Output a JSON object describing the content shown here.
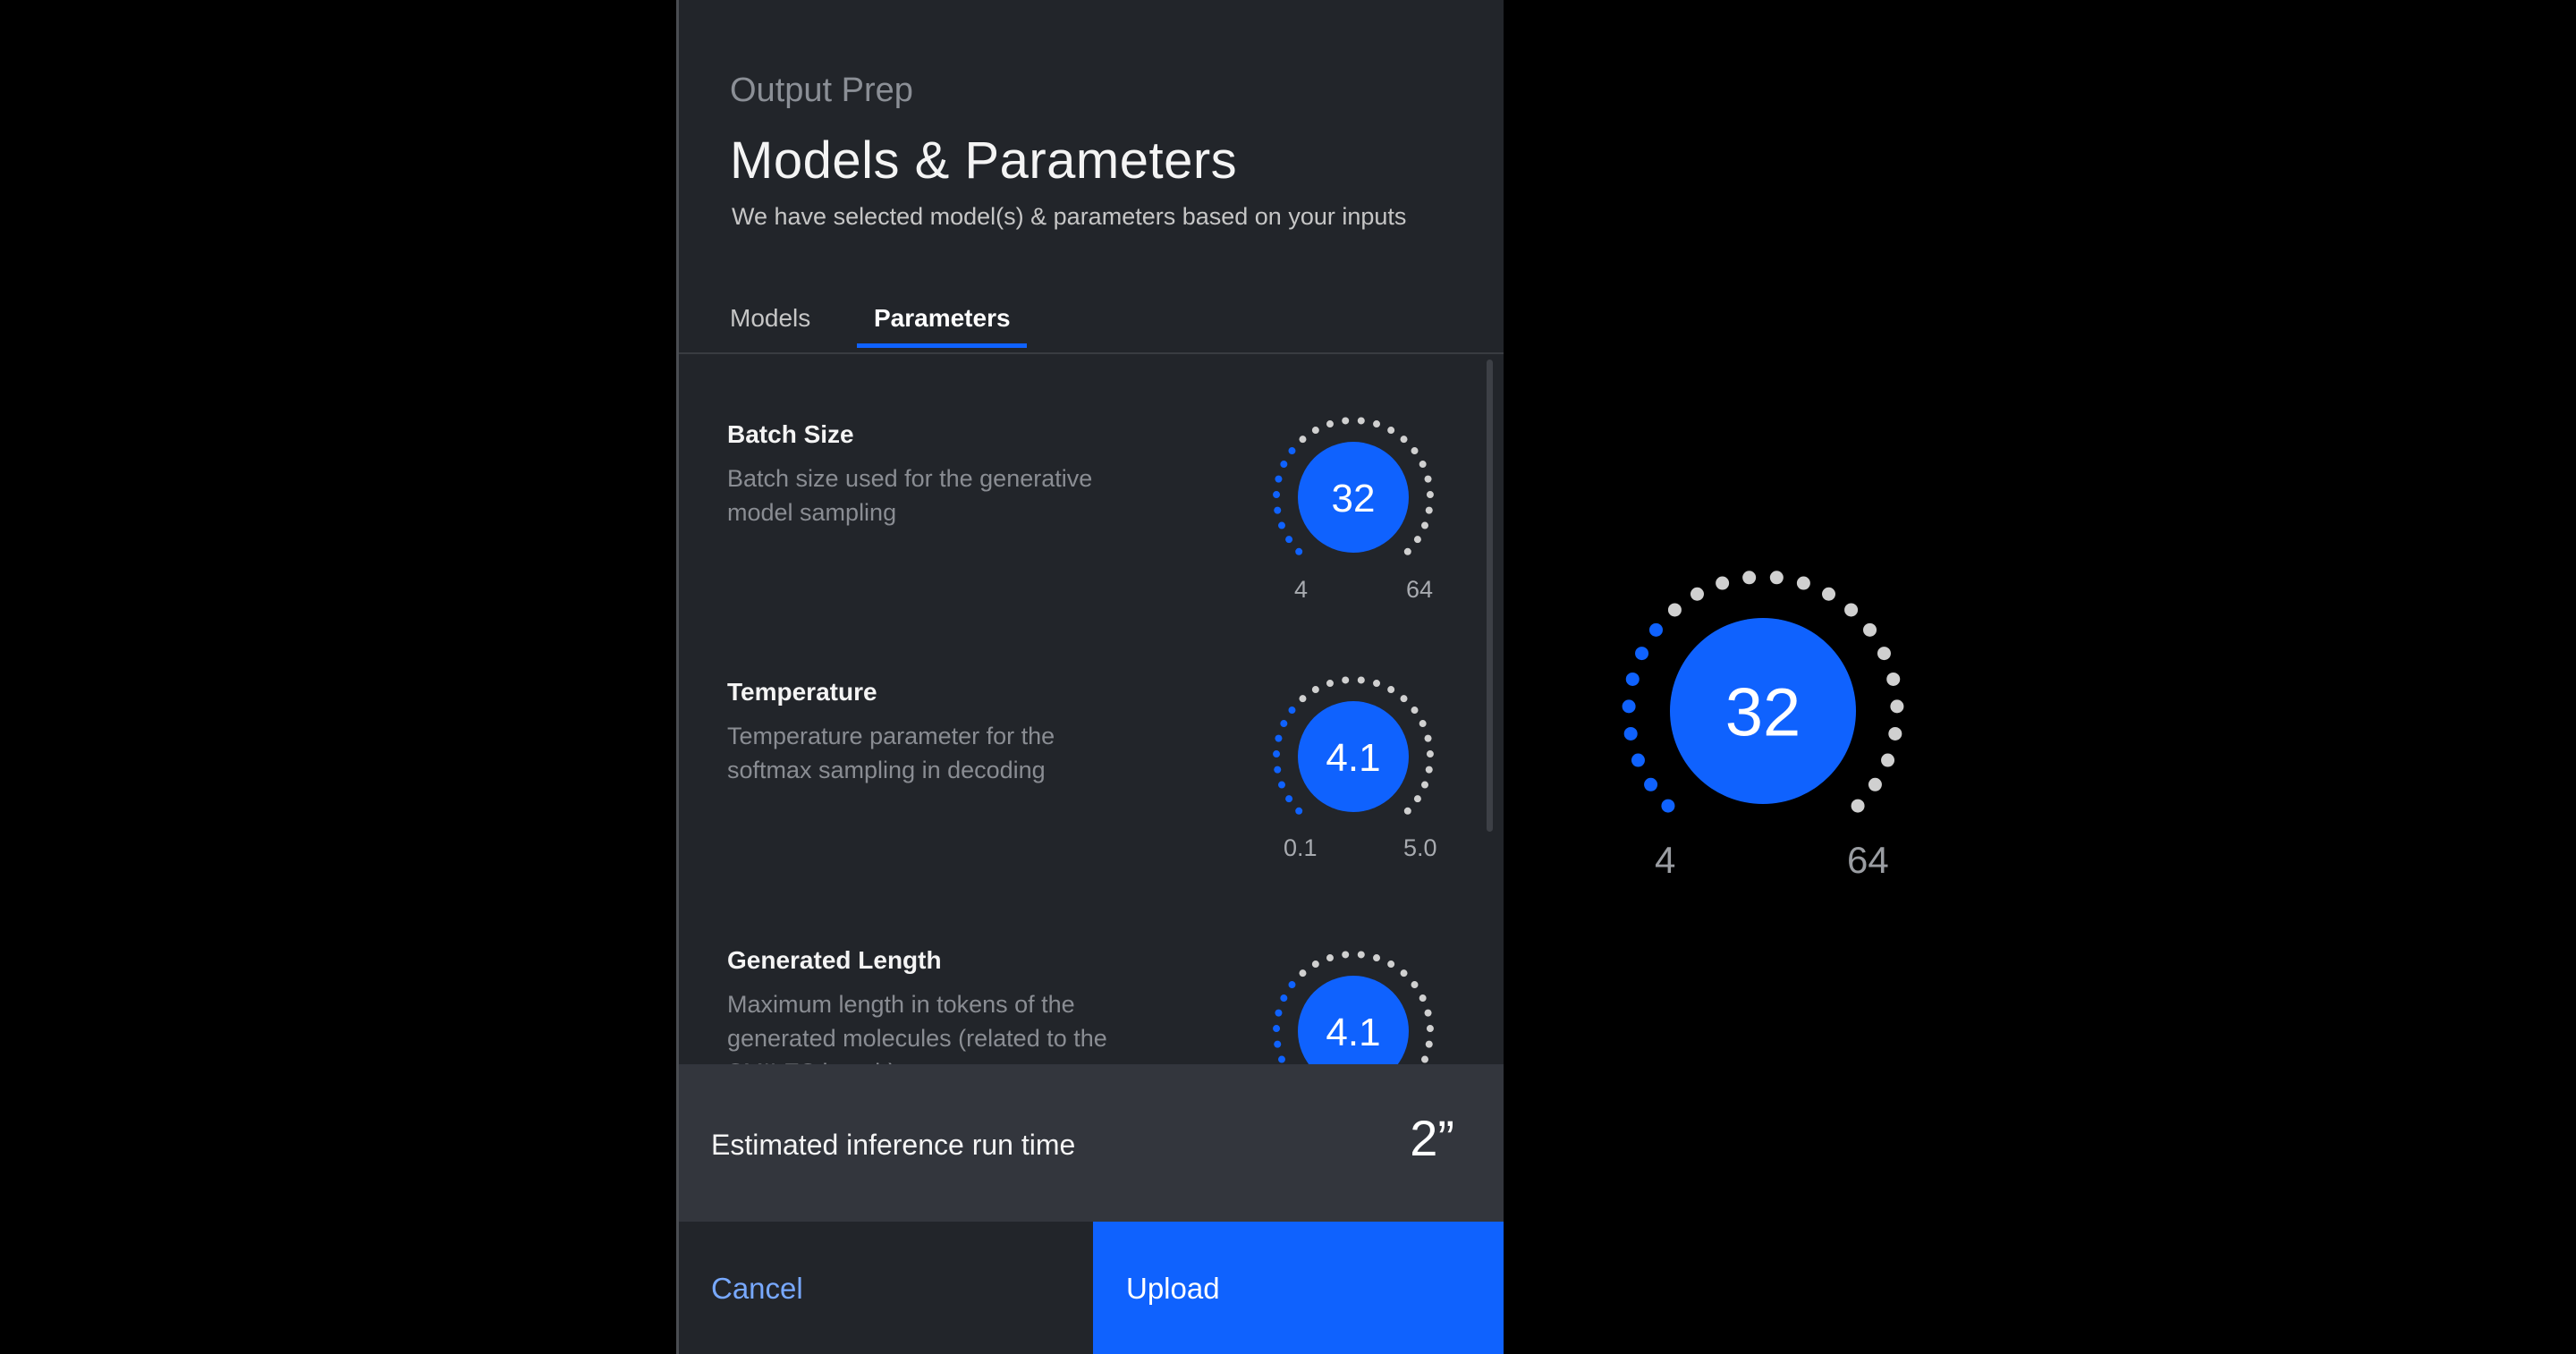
{
  "header": {
    "eyebrow": "Output Prep",
    "title": "Models & Parameters",
    "subtitle": "We have selected model(s) & parameters based on your inputs"
  },
  "tabs": [
    {
      "label": "Models",
      "active": false
    },
    {
      "label": "Parameters",
      "active": true
    }
  ],
  "parameters": [
    {
      "name": "Batch Size",
      "description_lines": [
        "Batch size used for the generative",
        "model sampling"
      ],
      "value": "32",
      "min": "4",
      "max": "64",
      "fraction": 0.3
    },
    {
      "name": "Temperature",
      "description_lines": [
        "Temperature parameter for the",
        "softmax sampling in decoding"
      ],
      "value": "4.1",
      "min": "0.1",
      "max": "5.0",
      "fraction": 0.3
    },
    {
      "name": "Generated Length",
      "description_lines": [
        "Maximum length in tokens of the",
        "generated molecules (related to the",
        "SMILES length)"
      ],
      "value": "4.1",
      "min": "",
      "max": "",
      "fraction": 0.3
    }
  ],
  "footer": {
    "estimate_label": "Estimated inference run time",
    "estimate_value": "2”",
    "cancel_label": "Cancel",
    "upload_label": "Upload"
  },
  "zoom_dial": {
    "value": "32",
    "min": "4",
    "max": "64",
    "fraction": 0.3
  },
  "colors": {
    "accent": "#0f62fe",
    "inactive_dot": "#d0d0d0",
    "panel": "#22252a"
  }
}
